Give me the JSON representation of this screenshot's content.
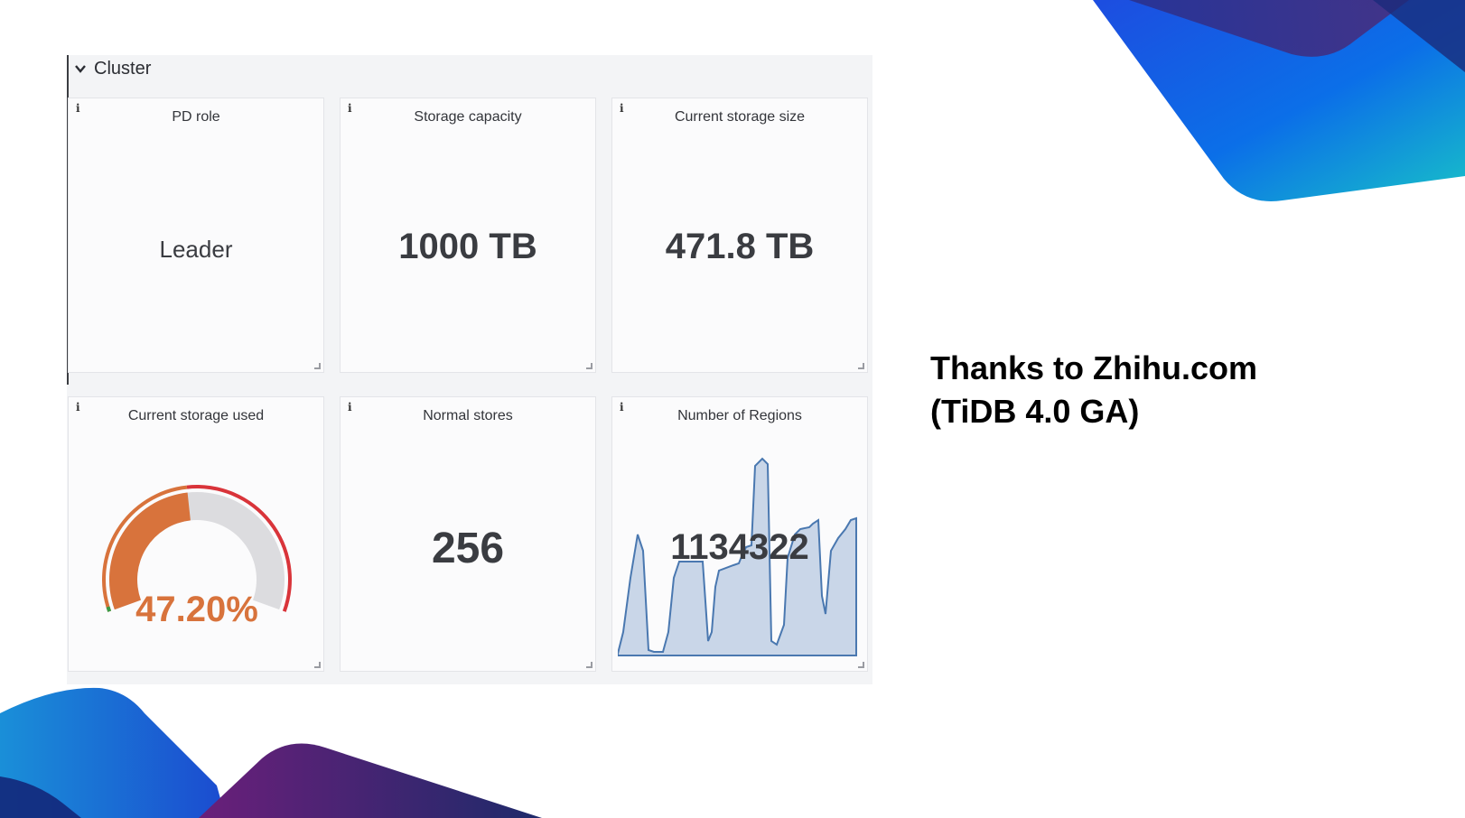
{
  "row": {
    "title": "Cluster",
    "icon": "chevron-down-icon"
  },
  "panels": {
    "pd_role": {
      "title": "PD role",
      "value": "Leader"
    },
    "storage_capacity": {
      "title": "Storage capacity",
      "value": "1000 TB"
    },
    "current_storage_size": {
      "title": "Current storage size",
      "value": "471.8 TB"
    },
    "current_storage_used": {
      "title": "Current storage used",
      "value": "47.20%",
      "percent": 47.2
    },
    "normal_stores": {
      "title": "Normal stores",
      "value": "256"
    },
    "number_of_regions": {
      "title": "Number of Regions",
      "value": "1134322"
    }
  },
  "info_icon_text": "i",
  "slide": {
    "line1": "Thanks to Zhihu.com",
    "line2": "(TiDB 4.0 GA)"
  },
  "colors": {
    "gauge_fill": "#d8733c",
    "gauge_track": "#dcdcdf",
    "gauge_threshold_red": "#d9343a",
    "gauge_threshold_green": "#3a9a46",
    "sparkline_line": "#4a78b0",
    "sparkline_fill": "#c9d6e8"
  }
}
